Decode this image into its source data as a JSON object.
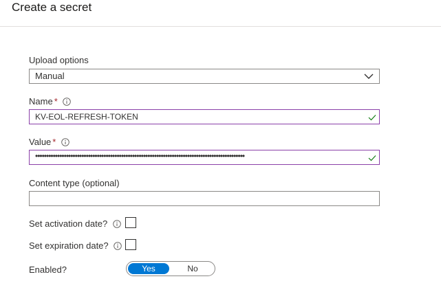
{
  "header": {
    "title": "Create a secret"
  },
  "form": {
    "upload_options": {
      "label": "Upload options",
      "value": "Manual"
    },
    "name": {
      "label": "Name",
      "required_mark": "*",
      "value": "KV-EOL-REFRESH-TOKEN",
      "valid": true
    },
    "value": {
      "label": "Value",
      "required_mark": "*",
      "masked_value": "•••••••••••••••••••••••••••••••••••••••••••••••••••••••••••••••••••••••••••••••••••••••••••••••",
      "valid": true
    },
    "content_type": {
      "label": "Content type (optional)",
      "value": ""
    },
    "activation_date": {
      "label": "Set activation date?",
      "checked": false
    },
    "expiration_date": {
      "label": "Set expiration date?",
      "checked": false
    },
    "enabled": {
      "label": "Enabled?",
      "yes_label": "Yes",
      "no_label": "No",
      "selected": "Yes"
    }
  },
  "colors": {
    "accent": "#0078d4",
    "valid_border": "#8a3fa8",
    "valid_check": "#107c10",
    "required": "#a4262c"
  },
  "icons": {
    "info": "info-icon",
    "chevron": "chevron-down-icon",
    "valid": "checkmark-icon"
  }
}
